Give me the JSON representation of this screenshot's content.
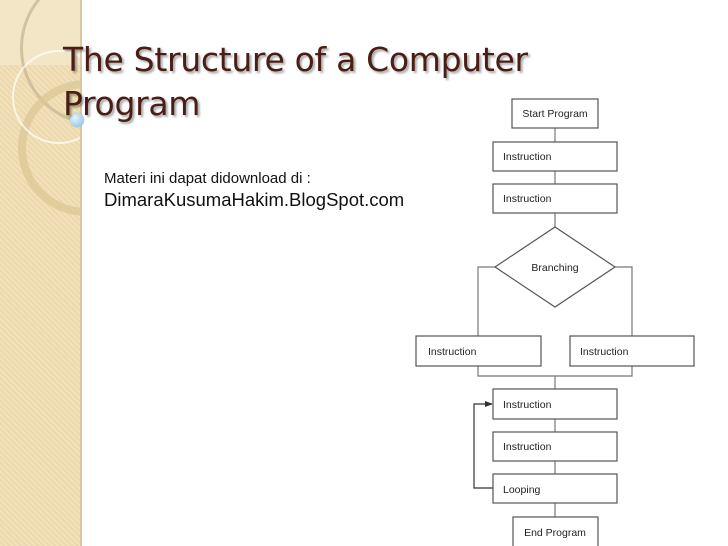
{
  "slide": {
    "title_line1": "The Structure of a Computer",
    "title_line2": "Program",
    "subtitle_line1": "Materi  ini dapat didownload di :",
    "subtitle_line2": "DimaraKusumaHakim.BlogSpot.com"
  },
  "flowchart": {
    "nodes": [
      {
        "id": "start",
        "type": "terminal",
        "label": "Start Program"
      },
      {
        "id": "instr1",
        "type": "process",
        "label": "Instruction"
      },
      {
        "id": "instr2",
        "type": "process",
        "label": "Instruction"
      },
      {
        "id": "branch",
        "type": "decision",
        "label": "Branching"
      },
      {
        "id": "instr_left",
        "type": "process",
        "label": "Instruction"
      },
      {
        "id": "instr_right",
        "type": "process",
        "label": "Instruction"
      },
      {
        "id": "instr3",
        "type": "process",
        "label": "Instruction"
      },
      {
        "id": "instr4",
        "type": "process",
        "label": "Instruction"
      },
      {
        "id": "loop",
        "type": "process",
        "label": "Looping"
      },
      {
        "id": "end",
        "type": "terminal",
        "label": "End Program"
      }
    ],
    "edges": [
      [
        "start",
        "instr1"
      ],
      [
        "instr1",
        "instr2"
      ],
      [
        "instr2",
        "branch"
      ],
      [
        "branch",
        "instr_left"
      ],
      [
        "branch",
        "instr_right"
      ],
      [
        "instr_left",
        "instr3"
      ],
      [
        "instr_right",
        "instr3"
      ],
      [
        "instr3",
        "instr4"
      ],
      [
        "instr4",
        "loop"
      ],
      [
        "loop",
        "instr3"
      ],
      [
        "loop",
        "end"
      ]
    ]
  }
}
